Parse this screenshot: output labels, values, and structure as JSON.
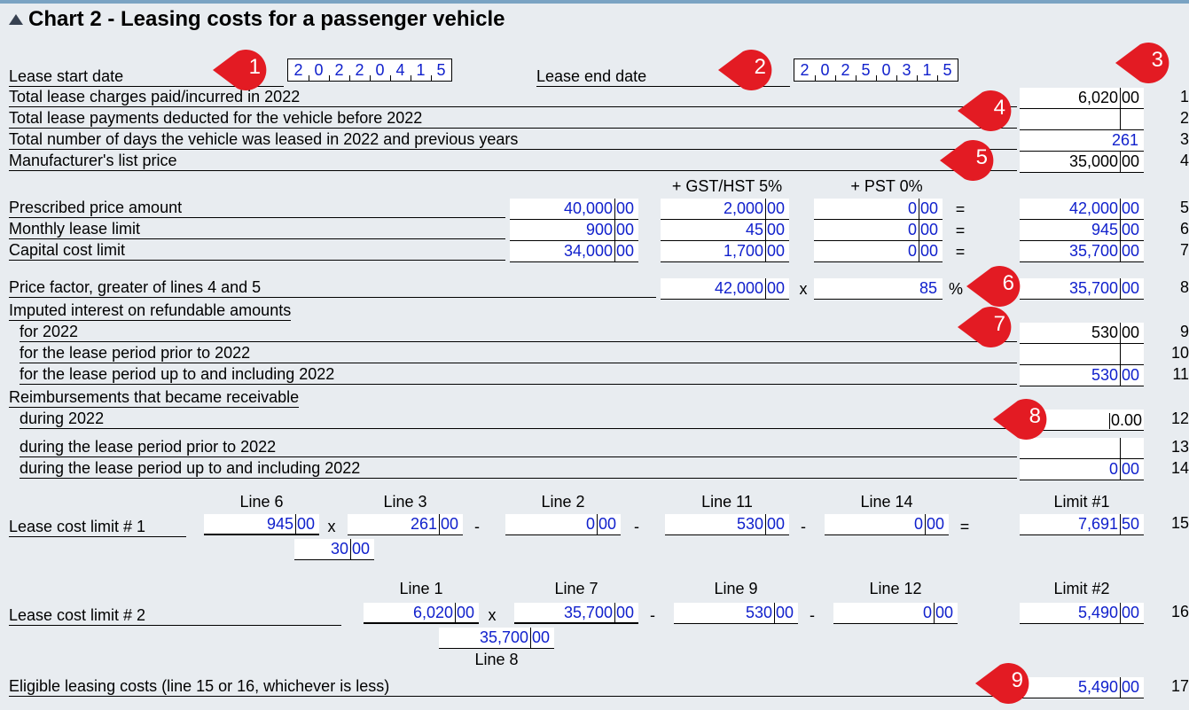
{
  "year": "2022",
  "title": "Chart 2 - Leasing costs for a passenger vehicle",
  "labels": {
    "lease_start": "Lease start date",
    "lease_end": "Lease end date",
    "line1": "Total lease charges paid/incurred in 2022",
    "line2": "Total lease payments deducted for the vehicle before 2022",
    "line3": "Total number of days the vehicle was leased in 2022 and previous years",
    "line4": "Manufacturer's list price",
    "gst_hdr": "+ GST/HST 5%",
    "pst_hdr": "+ PST 0%",
    "line5": "Prescribed price amount",
    "line6": "Monthly lease limit",
    "line7": "Capital cost limit",
    "line8": "Price factor, greater of lines 4 and 5",
    "imputed_hdr": "Imputed interest on refundable amounts",
    "line9": "for 2022",
    "line10": "for the lease period prior to 2022",
    "line11": "for the lease period up to and including 2022",
    "reimb_hdr": "Reimbursements that became receivable",
    "line12": "during 2022",
    "line13": "during the lease period prior to 2022",
    "line14": "during the lease period up to and including 2022",
    "lc1": "Lease cost limit # 1",
    "lc2": "Lease cost limit # 2",
    "eligible": "Eligible leasing costs (line 15 or 16, whichever is less)",
    "h_l6": "Line 6",
    "h_l3": "Line 3",
    "h_l2": "Line 2",
    "h_l11": "Line 11",
    "h_l14": "Line 14",
    "h_lim1": "Limit #1",
    "h_l1": "Line 1",
    "h_l7": "Line 7",
    "h_l9": "Line 9",
    "h_l12": "Line 12",
    "h_lim2": "Limit #2",
    "h_l8": "Line 8"
  },
  "lease_start_digits": [
    "2",
    "0",
    "2",
    "2",
    "0",
    "4",
    "1",
    "5"
  ],
  "lease_end_digits": [
    "2",
    "0",
    "2",
    "5",
    "0",
    "3",
    "1",
    "5"
  ],
  "lines": {
    "l1": {
      "dol": "6,020",
      "cents": "00",
      "black": true,
      "no": "1"
    },
    "l2": {
      "dol": "",
      "cents": "",
      "no": "2"
    },
    "l3": {
      "dol": "261",
      "single": true,
      "no": "3"
    },
    "l4": {
      "dol": "35,000",
      "cents": "00",
      "black": true,
      "no": "4"
    },
    "l5_base": {
      "dol": "40,000",
      "cents": "00"
    },
    "l5_gst": {
      "dol": "2,000",
      "cents": "00"
    },
    "l5_pst": {
      "dol": "0",
      "cents": "00"
    },
    "l5_tot": {
      "dol": "42,000",
      "cents": "00",
      "no": "5"
    },
    "l6_base": {
      "dol": "900",
      "cents": "00"
    },
    "l6_gst": {
      "dol": "45",
      "cents": "00"
    },
    "l6_pst": {
      "dol": "0",
      "cents": "00"
    },
    "l6_tot": {
      "dol": "945",
      "cents": "00",
      "no": "6"
    },
    "l7_base": {
      "dol": "34,000",
      "cents": "00"
    },
    "l7_gst": {
      "dol": "1,700",
      "cents": "00"
    },
    "l7_pst": {
      "dol": "0",
      "cents": "00"
    },
    "l7_tot": {
      "dol": "35,700",
      "cents": "00",
      "no": "7"
    },
    "l8_a": {
      "dol": "42,000",
      "cents": "00"
    },
    "l8_pct": {
      "val": "85"
    },
    "l8_tot": {
      "dol": "35,700",
      "cents": "00",
      "no": "8"
    },
    "l9": {
      "dol": "530",
      "cents": "00",
      "black": true,
      "no": "9"
    },
    "l10": {
      "dol": "",
      "cents": "",
      "no": "10"
    },
    "l11": {
      "dol": "530",
      "cents": "00",
      "no": "11"
    },
    "l12": {
      "val": "0.00",
      "no": "12"
    },
    "l13": {
      "dol": "",
      "cents": "",
      "no": "13"
    },
    "l14": {
      "dol": "0",
      "cents": "00",
      "no": "14"
    },
    "lc1_l6": {
      "dol": "945",
      "cents": "00"
    },
    "lc1_l3": {
      "dol": "261",
      "cents": "00"
    },
    "lc1_den": {
      "dol": "30",
      "cents": "00"
    },
    "lc1_l2": {
      "dol": "0",
      "cents": "00"
    },
    "lc1_l11": {
      "dol": "530",
      "cents": "00"
    },
    "lc1_l14": {
      "dol": "0",
      "cents": "00"
    },
    "lc1_tot": {
      "dol": "7,691",
      "cents": "50",
      "no": "15"
    },
    "lc2_l1": {
      "dol": "6,020",
      "cents": "00"
    },
    "lc2_l7": {
      "dol": "35,700",
      "cents": "00"
    },
    "lc2_den": {
      "dol": "35,700",
      "cents": "00"
    },
    "lc2_l9": {
      "dol": "530",
      "cents": "00"
    },
    "lc2_l12": {
      "dol": "0",
      "cents": "00"
    },
    "lc2_tot": {
      "dol": "5,490",
      "cents": "00",
      "no": "16"
    },
    "l17": {
      "dol": "5,490",
      "cents": "00",
      "no": "17"
    }
  },
  "callouts": {
    "c1": "1",
    "c2": "2",
    "c3": "3",
    "c4": "4",
    "c5": "5",
    "c6": "6",
    "c7": "7",
    "c8": "8",
    "c9": "9"
  }
}
